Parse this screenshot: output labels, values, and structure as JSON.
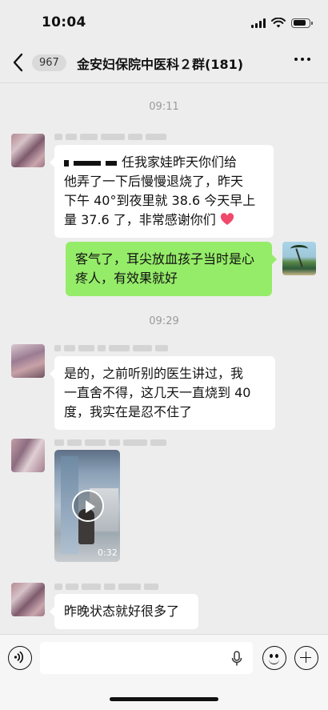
{
  "status_bar": {
    "time": "10:04",
    "icons": [
      "cellular-signal-icon",
      "wifi-icon",
      "battery-icon"
    ]
  },
  "nav": {
    "back_icon": "chevron-left-icon",
    "unread_count": "967",
    "title": "金安妇保院中医科２群(181)",
    "more_icon": "more-dots-icon"
  },
  "messages": [
    {
      "type": "time",
      "text": "09:11"
    },
    {
      "type": "text",
      "side": "left",
      "lines": [
        "任我家娃昨天你们给",
        "他弄了一下后慢慢退烧了，昨天",
        "下午 40°到夜里就 38.6 今天早上",
        "量 37.6 了，非常感谢你们"
      ],
      "emoji": "heart-icon"
    },
    {
      "type": "text",
      "side": "right",
      "lines": [
        "客气了，耳尖放血孩子当时是心",
        "疼人，有效果就好"
      ]
    },
    {
      "type": "time",
      "text": "09:29"
    },
    {
      "type": "text",
      "side": "left",
      "lines": [
        "是的，之前听别的医生讲过，我",
        "一直舍不得，这几天一直烧到 40",
        "度，我实在是忍不住了"
      ]
    },
    {
      "type": "video",
      "side": "left",
      "duration": "0:32"
    },
    {
      "type": "text",
      "side": "left",
      "lines": [
        "昨晚状态就好很多了"
      ]
    }
  ],
  "input_bar": {
    "voice_icon": "voice-icon",
    "mic_icon": "microphone-icon",
    "emoji_icon": "emoji-icon",
    "plus_icon": "plus-icon"
  },
  "colors": {
    "background": "#ededed",
    "bubble_incoming": "#ffffff",
    "bubble_outgoing": "#95ec69",
    "timestamp": "#9a9a9a"
  }
}
